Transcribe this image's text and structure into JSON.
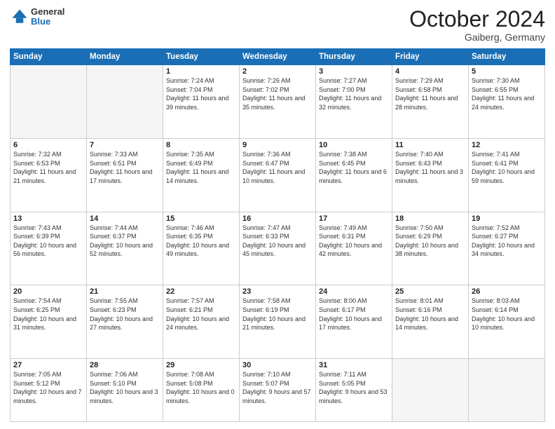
{
  "header": {
    "logo": {
      "general": "General",
      "blue": "Blue"
    },
    "title": "October 2024",
    "location": "Gaiberg, Germany"
  },
  "calendar": {
    "weekdays": [
      "Sunday",
      "Monday",
      "Tuesday",
      "Wednesday",
      "Thursday",
      "Friday",
      "Saturday"
    ],
    "weeks": [
      [
        {
          "day": "",
          "empty": true
        },
        {
          "day": "",
          "empty": true
        },
        {
          "day": "1",
          "sunrise": "Sunrise: 7:24 AM",
          "sunset": "Sunset: 7:04 PM",
          "daylight": "Daylight: 11 hours and 39 minutes."
        },
        {
          "day": "2",
          "sunrise": "Sunrise: 7:26 AM",
          "sunset": "Sunset: 7:02 PM",
          "daylight": "Daylight: 11 hours and 35 minutes."
        },
        {
          "day": "3",
          "sunrise": "Sunrise: 7:27 AM",
          "sunset": "Sunset: 7:00 PM",
          "daylight": "Daylight: 11 hours and 32 minutes."
        },
        {
          "day": "4",
          "sunrise": "Sunrise: 7:29 AM",
          "sunset": "Sunset: 6:58 PM",
          "daylight": "Daylight: 11 hours and 28 minutes."
        },
        {
          "day": "5",
          "sunrise": "Sunrise: 7:30 AM",
          "sunset": "Sunset: 6:55 PM",
          "daylight": "Daylight: 11 hours and 24 minutes."
        }
      ],
      [
        {
          "day": "6",
          "sunrise": "Sunrise: 7:32 AM",
          "sunset": "Sunset: 6:53 PM",
          "daylight": "Daylight: 11 hours and 21 minutes."
        },
        {
          "day": "7",
          "sunrise": "Sunrise: 7:33 AM",
          "sunset": "Sunset: 6:51 PM",
          "daylight": "Daylight: 11 hours and 17 minutes."
        },
        {
          "day": "8",
          "sunrise": "Sunrise: 7:35 AM",
          "sunset": "Sunset: 6:49 PM",
          "daylight": "Daylight: 11 hours and 14 minutes."
        },
        {
          "day": "9",
          "sunrise": "Sunrise: 7:36 AM",
          "sunset": "Sunset: 6:47 PM",
          "daylight": "Daylight: 11 hours and 10 minutes."
        },
        {
          "day": "10",
          "sunrise": "Sunrise: 7:38 AM",
          "sunset": "Sunset: 6:45 PM",
          "daylight": "Daylight: 11 hours and 6 minutes."
        },
        {
          "day": "11",
          "sunrise": "Sunrise: 7:40 AM",
          "sunset": "Sunset: 6:43 PM",
          "daylight": "Daylight: 11 hours and 3 minutes."
        },
        {
          "day": "12",
          "sunrise": "Sunrise: 7:41 AM",
          "sunset": "Sunset: 6:41 PM",
          "daylight": "Daylight: 10 hours and 59 minutes."
        }
      ],
      [
        {
          "day": "13",
          "sunrise": "Sunrise: 7:43 AM",
          "sunset": "Sunset: 6:39 PM",
          "daylight": "Daylight: 10 hours and 56 minutes."
        },
        {
          "day": "14",
          "sunrise": "Sunrise: 7:44 AM",
          "sunset": "Sunset: 6:37 PM",
          "daylight": "Daylight: 10 hours and 52 minutes."
        },
        {
          "day": "15",
          "sunrise": "Sunrise: 7:46 AM",
          "sunset": "Sunset: 6:35 PM",
          "daylight": "Daylight: 10 hours and 49 minutes."
        },
        {
          "day": "16",
          "sunrise": "Sunrise: 7:47 AM",
          "sunset": "Sunset: 6:33 PM",
          "daylight": "Daylight: 10 hours and 45 minutes."
        },
        {
          "day": "17",
          "sunrise": "Sunrise: 7:49 AM",
          "sunset": "Sunset: 6:31 PM",
          "daylight": "Daylight: 10 hours and 42 minutes."
        },
        {
          "day": "18",
          "sunrise": "Sunrise: 7:50 AM",
          "sunset": "Sunset: 6:29 PM",
          "daylight": "Daylight: 10 hours and 38 minutes."
        },
        {
          "day": "19",
          "sunrise": "Sunrise: 7:52 AM",
          "sunset": "Sunset: 6:27 PM",
          "daylight": "Daylight: 10 hours and 34 minutes."
        }
      ],
      [
        {
          "day": "20",
          "sunrise": "Sunrise: 7:54 AM",
          "sunset": "Sunset: 6:25 PM",
          "daylight": "Daylight: 10 hours and 31 minutes."
        },
        {
          "day": "21",
          "sunrise": "Sunrise: 7:55 AM",
          "sunset": "Sunset: 6:23 PM",
          "daylight": "Daylight: 10 hours and 27 minutes."
        },
        {
          "day": "22",
          "sunrise": "Sunrise: 7:57 AM",
          "sunset": "Sunset: 6:21 PM",
          "daylight": "Daylight: 10 hours and 24 minutes."
        },
        {
          "day": "23",
          "sunrise": "Sunrise: 7:58 AM",
          "sunset": "Sunset: 6:19 PM",
          "daylight": "Daylight: 10 hours and 21 minutes."
        },
        {
          "day": "24",
          "sunrise": "Sunrise: 8:00 AM",
          "sunset": "Sunset: 6:17 PM",
          "daylight": "Daylight: 10 hours and 17 minutes."
        },
        {
          "day": "25",
          "sunrise": "Sunrise: 8:01 AM",
          "sunset": "Sunset: 6:16 PM",
          "daylight": "Daylight: 10 hours and 14 minutes."
        },
        {
          "day": "26",
          "sunrise": "Sunrise: 8:03 AM",
          "sunset": "Sunset: 6:14 PM",
          "daylight": "Daylight: 10 hours and 10 minutes."
        }
      ],
      [
        {
          "day": "27",
          "sunrise": "Sunrise: 7:05 AM",
          "sunset": "Sunset: 5:12 PM",
          "daylight": "Daylight: 10 hours and 7 minutes."
        },
        {
          "day": "28",
          "sunrise": "Sunrise: 7:06 AM",
          "sunset": "Sunset: 5:10 PM",
          "daylight": "Daylight: 10 hours and 3 minutes."
        },
        {
          "day": "29",
          "sunrise": "Sunrise: 7:08 AM",
          "sunset": "Sunset: 5:08 PM",
          "daylight": "Daylight: 10 hours and 0 minutes."
        },
        {
          "day": "30",
          "sunrise": "Sunrise: 7:10 AM",
          "sunset": "Sunset: 5:07 PM",
          "daylight": "Daylight: 9 hours and 57 minutes."
        },
        {
          "day": "31",
          "sunrise": "Sunrise: 7:11 AM",
          "sunset": "Sunset: 5:05 PM",
          "daylight": "Daylight: 9 hours and 53 minutes."
        },
        {
          "day": "",
          "empty": true
        },
        {
          "day": "",
          "empty": true
        }
      ]
    ]
  }
}
